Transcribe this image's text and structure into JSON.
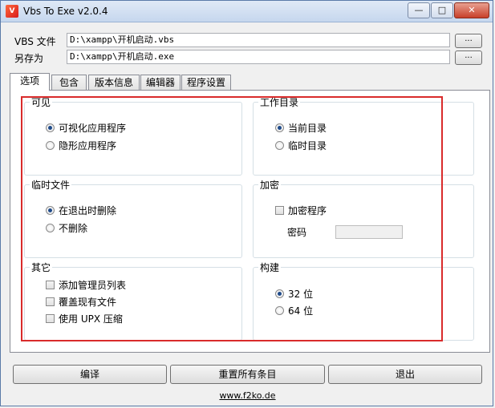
{
  "window": {
    "title": "Vbs To Exe v2.0.4",
    "min": "—",
    "max": "□",
    "close": "✕"
  },
  "files": {
    "vbs_label": "VBS 文件",
    "vbs_value": "D:\\xampp\\开机启动.vbs",
    "save_label": "另存为",
    "save_value": "D:\\xampp\\开机启动.exe",
    "browse": "..."
  },
  "tabs": [
    "选项",
    "包含",
    "版本信息",
    "编辑器",
    "程序设置"
  ],
  "groups": {
    "visible": {
      "title": "可见",
      "options": [
        "可视化应用程序",
        "隐形应用程序"
      ]
    },
    "workdir": {
      "title": "工作目录",
      "options": [
        "当前目录",
        "临时目录"
      ]
    },
    "tempfiles": {
      "title": "临时文件",
      "options": [
        "在退出时删除",
        "不删除"
      ]
    },
    "encrypt": {
      "title": "加密",
      "checkbox": "加密程序",
      "password_label": "密码"
    },
    "other": {
      "title": "其它",
      "checks": [
        "添加管理员列表",
        "覆盖现有文件",
        "使用 UPX 压缩"
      ]
    },
    "build": {
      "title": "构建",
      "options": [
        "32 位",
        "64 位"
      ]
    }
  },
  "buttons": {
    "compile": "编译",
    "reset": "重置所有条目",
    "exit": "退出"
  },
  "footer_link": "www.f2ko.de",
  "colors": {
    "highlight": "#d92b2b",
    "window_border": "#5a7aa8"
  }
}
